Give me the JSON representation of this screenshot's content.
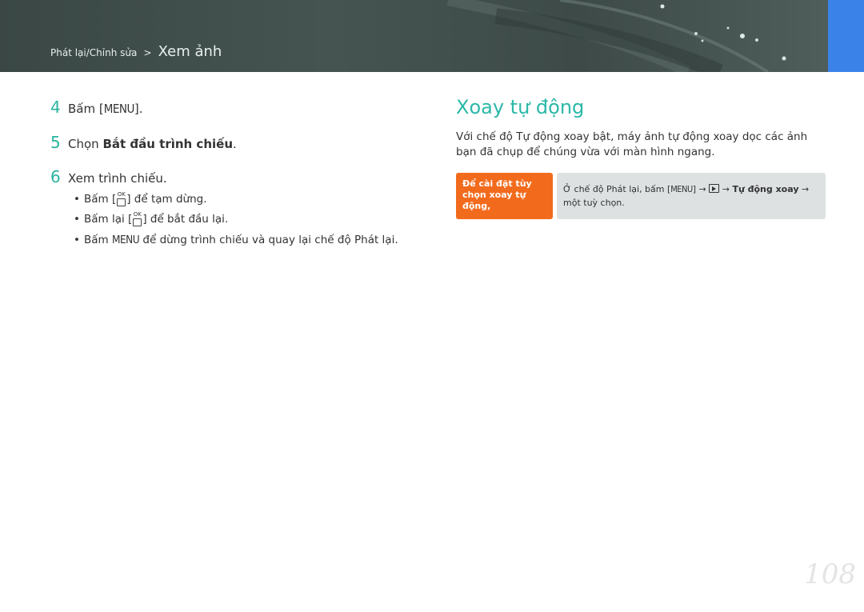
{
  "header": {
    "breadcrumb_parent": "Phát lại/Chỉnh sửa",
    "breadcrumb_sep": ">",
    "breadcrumb_current": "Xem ảnh"
  },
  "steps": [
    {
      "num": "4",
      "pre": "Bấm [",
      "menu": "MENU",
      "post": "]."
    },
    {
      "num": "5",
      "pre": "Chọn ",
      "bold": "Bắt đầu trình chiếu",
      "post": "."
    },
    {
      "num": "6",
      "text": "Xem trình chiếu."
    }
  ],
  "bullets": [
    {
      "pre": "Bấm [",
      "ok": "OK",
      "post": "] để tạm dừng."
    },
    {
      "pre": "Bấm lại [",
      "ok": "OK",
      "post": "] để bắt đầu lại."
    },
    {
      "pre": "Bấm ",
      "menu": "MENU",
      "post": " để dừng trình chiếu và quay lại chế độ Phát lại."
    }
  ],
  "section": {
    "title": "Xoay tự động",
    "paragraph": "Với chế độ Tự động xoay bật, máy ảnh tự động xoay dọc các ảnh bạn đã chụp để chúng vừa với màn hình ngang."
  },
  "note": {
    "label": "Để cài đặt tùy chọn xoay tự động,",
    "text_pre": "Ở chế độ Phát lại, bấm [",
    "menu": "MENU",
    "text_arrow1": "] →",
    "text_arrow2": "→",
    "bold": "Tự động xoay",
    "text_arrow3": "→",
    "text_post": "một tuỳ chọn."
  },
  "page_number": "108",
  "colors": {
    "accent": "#2bb8a8",
    "note_orange": "#f26b1d",
    "tab_blue": "#3b82e8",
    "banner": "#3f4c4a"
  }
}
